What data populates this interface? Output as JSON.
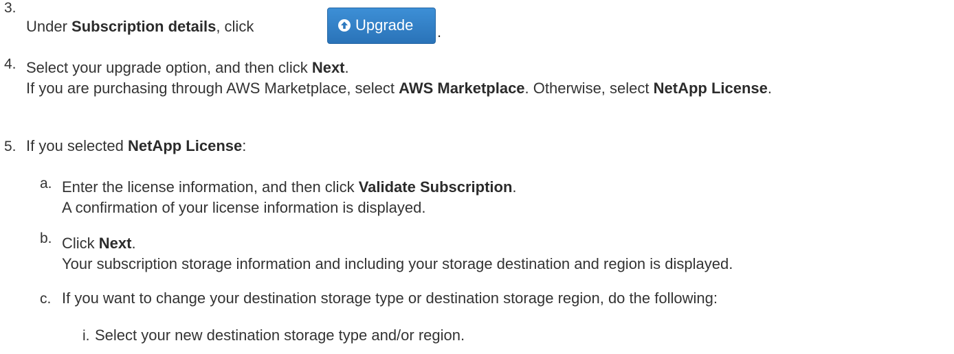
{
  "steps": [
    {
      "number": "3.",
      "prefix": "Under ",
      "bold": "Subscription details",
      "suffix": ", click",
      "after_button": ".",
      "button_label": "Upgrade"
    },
    {
      "number": "4.",
      "line1_prefix": "Select your upgrade option, and then click ",
      "line1_bold": "Next",
      "line1_suffix": ".",
      "line2_prefix": "If you are purchasing through AWS Marketplace, select ",
      "line2_bold1": "AWS Marketplace",
      "line2_mid": ". Otherwise, select ",
      "line2_bold2": "NetApp License",
      "line2_suffix": "."
    },
    {
      "number": "5.",
      "prefix": "If you selected ",
      "bold": "NetApp License",
      "suffix": ":"
    }
  ],
  "substeps": [
    {
      "letter": "a.",
      "line1_prefix": "Enter the license information, and then click ",
      "line1_bold": "Validate Subscription",
      "line1_suffix": ".",
      "line2": "A confirmation of your license information is displayed."
    },
    {
      "letter": "b.",
      "line1_prefix": "Click ",
      "line1_bold": "Next",
      "line1_suffix": ".",
      "line2": "Your subscription storage information and including your storage destination and region is displayed."
    },
    {
      "letter": "c.",
      "line1": "If you want to change your destination storage type or destination storage region, do the following:"
    }
  ],
  "subsubsteps": [
    {
      "numeral": "i.",
      "text": "Select your new destination storage type and/or region."
    }
  ]
}
